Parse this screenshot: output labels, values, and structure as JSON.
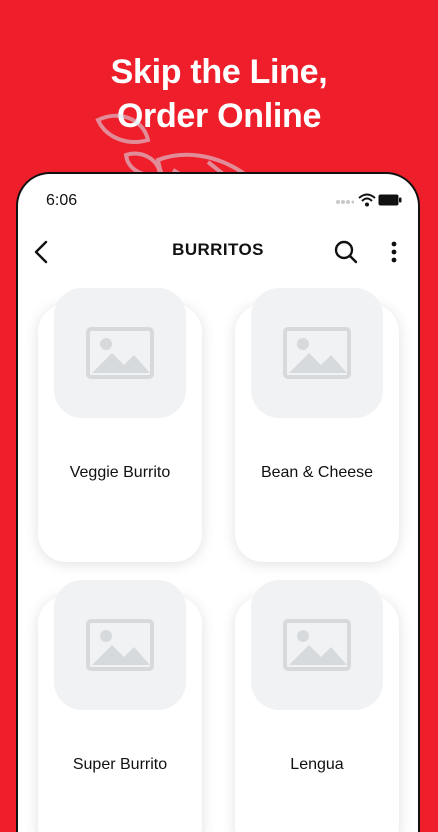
{
  "promo": {
    "line1": "Skip the Line,",
    "line2": "Order Online"
  },
  "status_bar": {
    "time": "6:06",
    "icons": [
      "signal-dots-icon",
      "wifi-icon",
      "battery-icon"
    ]
  },
  "nav": {
    "title": "BURRITOS",
    "icons": [
      "back-arrow-icon",
      "search-icon",
      "more-vertical-icon"
    ]
  },
  "items": [
    {
      "name": "Veggie Burrito",
      "image": "image-placeholder-icon"
    },
    {
      "name": "Bean & Cheese",
      "image": "image-placeholder-icon"
    },
    {
      "name": "Super Burrito",
      "image": "image-placeholder-icon"
    },
    {
      "name": "Lengua",
      "image": "image-placeholder-icon"
    }
  ],
  "colors": {
    "brand_red": "#ee1f2b",
    "card_bg": "#ffffff",
    "placeholder_bg": "#f1f2f4",
    "placeholder_icon": "#d7dadd"
  }
}
